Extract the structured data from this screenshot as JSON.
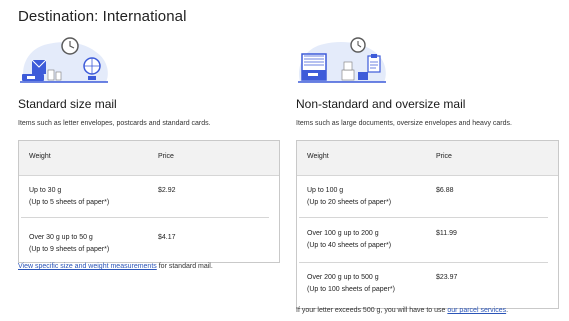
{
  "page": {
    "title": "Destination: International"
  },
  "standard": {
    "title": "Standard size mail",
    "description": "Items such as letter envelopes, postcards and standard cards.",
    "table": {
      "headers": {
        "weight": "Weight",
        "price": "Price"
      },
      "rows": [
        {
          "weight": "Up to 30 g",
          "note": "(Up to 5 sheets of paper*)",
          "price": "$2.92"
        },
        {
          "weight": "Over 30 g up to 50 g",
          "note": "(Up to 9 sheets of paper*)",
          "price": "$4.17"
        }
      ]
    },
    "footnote": {
      "link": "View specific size and weight measurements",
      "text": " for standard mail."
    }
  },
  "oversize": {
    "title": "Non-standard and oversize mail",
    "description": "Items such as large documents, oversize envelopes and heavy cards.",
    "table": {
      "headers": {
        "weight": "Weight",
        "price": "Price"
      },
      "rows": [
        {
          "weight": "Up to 100 g",
          "note": "(Up to 20 sheets of paper*)",
          "price": "$6.88"
        },
        {
          "weight": "Over 100 g up to 200 g",
          "note": "(Up to 40 sheets of paper*)",
          "price": "$11.99"
        },
        {
          "weight": "Over 200 g up to 500 g",
          "note": "(Up to 100 sheets of paper*)",
          "price": "$23.97"
        }
      ]
    },
    "footnote": {
      "text": "If your letter exceeds 500 g, you will have to use ",
      "link": "our parcel services",
      "end": "."
    }
  },
  "colors": {
    "accent": "#2b55b8",
    "illustration_blue": "#3d5bd9",
    "illustration_cloud": "#e4ebfa",
    "table_header_bg": "#f2f2f2"
  },
  "icons": {
    "standard_illustration": "envelope-globe-clock-illustration",
    "oversize_illustration": "mailbox-packages-clock-illustration"
  }
}
